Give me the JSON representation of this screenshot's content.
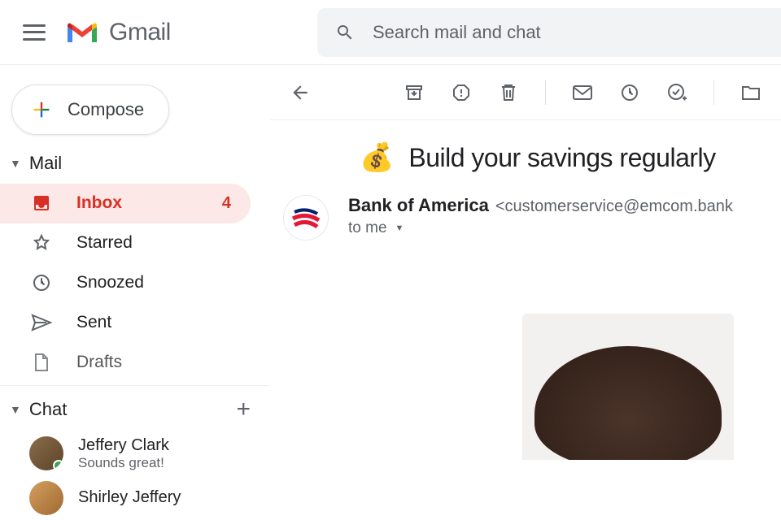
{
  "header": {
    "app_name": "Gmail",
    "search_placeholder": "Search mail and chat"
  },
  "compose": {
    "label": "Compose"
  },
  "mail_section": {
    "label": "Mail"
  },
  "nav": {
    "inbox": {
      "label": "Inbox",
      "count": "4"
    },
    "starred": {
      "label": "Starred"
    },
    "snoozed": {
      "label": "Snoozed"
    },
    "sent": {
      "label": "Sent"
    },
    "drafts": {
      "label": "Drafts"
    }
  },
  "chat_section": {
    "label": "Chat"
  },
  "chats": [
    {
      "name": "Jeffery Clark",
      "preview": "Sounds great!"
    },
    {
      "name": "Shirley Jeffery",
      "preview": ""
    }
  ],
  "email": {
    "subject_emoji": "💰",
    "subject": "Build your savings regularly",
    "sender_name": "Bank of America",
    "sender_email": "<customerservice@emcom.bank",
    "to": "to me"
  }
}
